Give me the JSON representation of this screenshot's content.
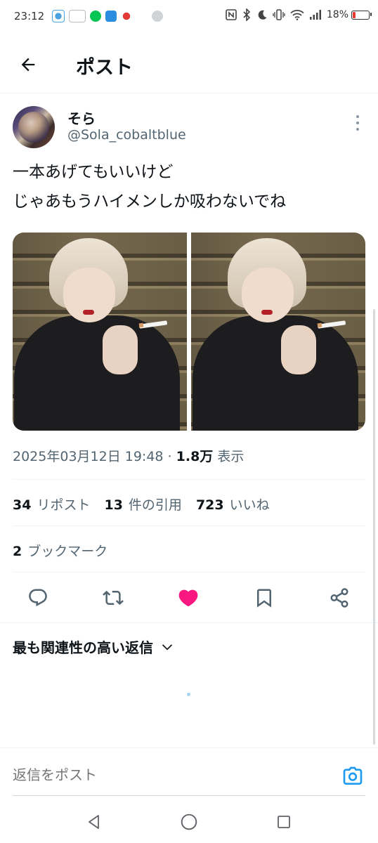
{
  "status_bar": {
    "time": "23:12",
    "battery_percent": "18%",
    "battery_level": 0.18,
    "left_icons": [
      "app-icon-1",
      "app-icon-2",
      "line-icon",
      "youtube-icon",
      "app-icon-3",
      "assistant-icon"
    ],
    "right_icons": [
      "nfc-icon",
      "bluetooth-icon",
      "dnd-moon-icon",
      "vibrate-icon",
      "wifi-icon",
      "signal-icon",
      "battery-icon"
    ]
  },
  "header": {
    "title": "ポスト",
    "back_icon": "arrow-left-icon"
  },
  "post": {
    "display_name": "そら",
    "handle": "@Sola_cobaltblue",
    "text_lines": [
      "一本あげてもいいけど",
      "じゃあもうハイメンしか吸わないでね"
    ],
    "timestamp": "2025年03月12日 19:48",
    "separator": " · ",
    "views_count": "1.8万",
    "views_label": " 表示",
    "stats": {
      "reposts_count": "34",
      "reposts_label": "リポスト",
      "quotes_count": "13",
      "quotes_label": "件の引用",
      "likes_count": "723",
      "likes_label": "いいね",
      "bookmarks_count": "2",
      "bookmarks_label": "ブックマーク"
    },
    "liked": true,
    "colors": {
      "like_active": "#f91880",
      "icon_default": "#536471",
      "accent": "#1d9bf0",
      "text_primary": "#0f1419",
      "text_secondary": "#536471"
    }
  },
  "replies": {
    "sort_label": "最も関連性の高い返信",
    "sort_icon": "chevron-down-icon"
  },
  "reply_composer": {
    "placeholder": "返信をポスト",
    "camera_icon": "camera-icon"
  },
  "nav": {
    "back_icon": "triangle-back-icon",
    "home_icon": "circle-home-icon",
    "recents_icon": "square-recents-icon"
  }
}
